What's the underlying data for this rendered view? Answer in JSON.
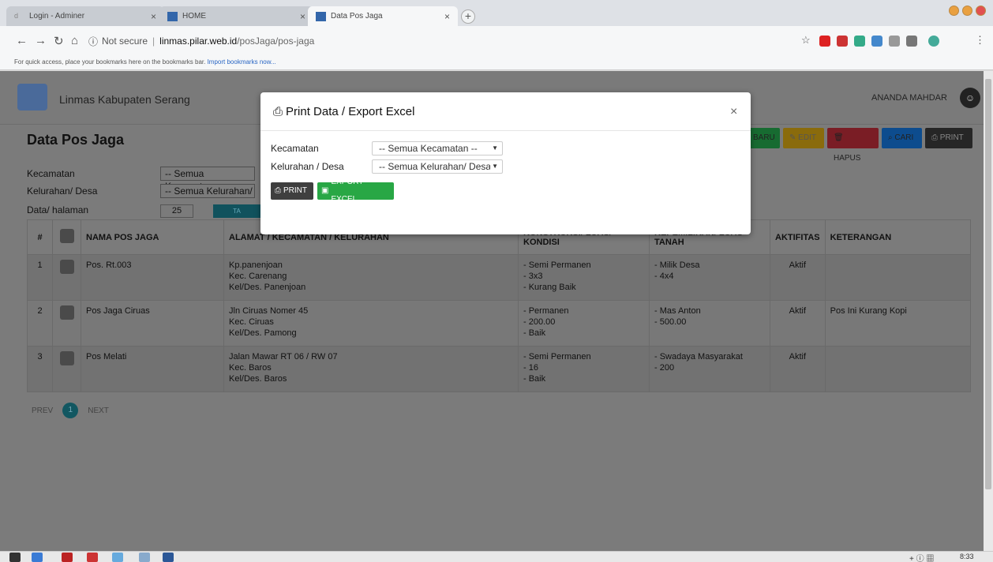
{
  "browser": {
    "tabs": [
      {
        "label": "Login - Adminer"
      },
      {
        "label": "HOME"
      },
      {
        "label": "Data Pos Jaga"
      }
    ],
    "security_label": "Not secure",
    "url_host": "linmas.pilar.web.id",
    "url_path": "/posJaga/pos-jaga",
    "bookmarks_hint": "For quick access, place your bookmarks here on the bookmarks bar.",
    "bookmarks_link": "Import bookmarks now..."
  },
  "app": {
    "name": "Linmas Kabupaten Serang",
    "user": "ANANDA MAHDAR"
  },
  "page": {
    "title": "Data Pos Jaga",
    "buttons": {
      "baru": "BARU",
      "edit": "EDIT",
      "hapus": "HAPUS",
      "cari": "CARI",
      "print": "PRINT"
    },
    "filters": {
      "kecamatan_label": "Kecamatan",
      "kecamatan_value": "-- Semua Kecamatan",
      "kelurahan_label": "Kelurahan/ Desa",
      "kelurahan_value": "-- Semua Kelurahan/",
      "halaman_label": "Data/ halaman",
      "halaman_value": "25",
      "tampil_label": "TA"
    },
    "table": {
      "headers": {
        "no": "#",
        "nama": "NAMA POS JAGA",
        "alamat": "ALAMAT / KECAMATAN / KELURAHAN",
        "konstruksi": "KONSTRUKSI/ LUAS/ KONDISI",
        "kepemilikan": "KEPEMILIKAN/ LUAS TANAH",
        "aktifitas": "AKTIFITAS",
        "keterangan": "KETERANGAN"
      },
      "rows": [
        {
          "no": "1",
          "nama": "Pos. Rt.003",
          "alamat": [
            "Kp.panenjoan",
            "Kec. Carenang",
            "Kel/Des. Panenjoan"
          ],
          "konstruksi": [
            "- Semi Permanen",
            "- 3x3",
            "- Kurang Baik"
          ],
          "kepemilikan": [
            "- Milik Desa",
            "- 4x4"
          ],
          "aktifitas": "Aktif",
          "keterangan": ""
        },
        {
          "no": "2",
          "nama": "Pos Jaga Ciruas",
          "alamat": [
            "Jln Ciruas Nomer 45",
            "Kec. Ciruas",
            "Kel/Des. Pamong"
          ],
          "konstruksi": [
            "- Permanen",
            "- 200.00",
            "- Baik"
          ],
          "kepemilikan": [
            "- Mas Anton",
            "- 500.00"
          ],
          "aktifitas": "Aktif",
          "keterangan": "Pos Ini Kurang Kopi"
        },
        {
          "no": "3",
          "nama": "Pos Melati",
          "alamat": [
            "Jalan Mawar RT 06 / RW 07",
            "Kec. Baros",
            "Kel/Des. Baros"
          ],
          "konstruksi": [
            "- Semi Permanen",
            "- 16",
            "- Baik"
          ],
          "kepemilikan": [
            "- Swadaya Masyarakat",
            "- 200"
          ],
          "aktifitas": "Aktif",
          "keterangan": ""
        }
      ]
    },
    "pager": {
      "prev": "PREV",
      "current": "1",
      "next": "NEXT"
    }
  },
  "modal": {
    "title": "Print Data / Export Excel",
    "close": "×",
    "kecamatan_label": "Kecamatan",
    "kecamatan_value": "-- Semua Kecamatan --",
    "kelurahan_label": "Kelurahan / Desa",
    "kelurahan_value": "-- Semua Kelurahan/ Desa",
    "print_label": "PRINT",
    "export_label": "EXPORT EXCEL"
  },
  "taskbar": {
    "time": "8:33"
  },
  "colors": {
    "primary": "#1ba0b4",
    "success": "#28a745",
    "warning": "#ffc107",
    "danger": "#dc3545",
    "info": "#007bff",
    "dark": "#343a40"
  }
}
